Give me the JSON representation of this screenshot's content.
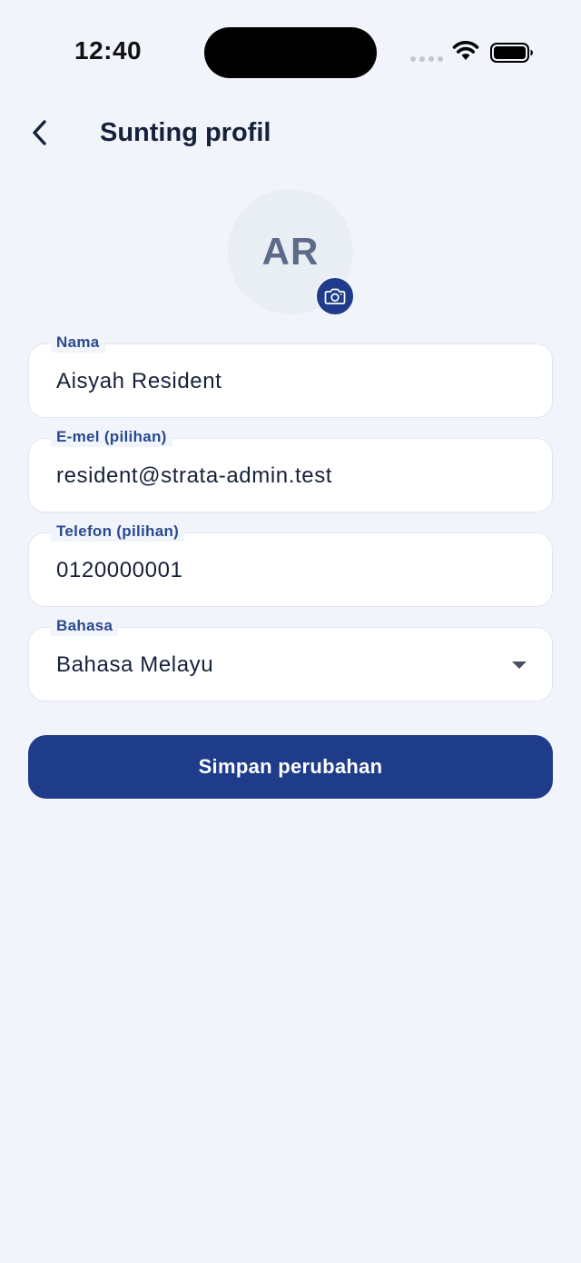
{
  "status_bar": {
    "time": "12:40"
  },
  "header": {
    "title": "Sunting profil",
    "back_icon": "chevron-left-icon"
  },
  "avatar": {
    "initials": "AR",
    "camera_icon": "camera-icon"
  },
  "form": {
    "fields": [
      {
        "label": "Nama",
        "value": "Aisyah Resident"
      },
      {
        "label": "E-mel (pilihan)",
        "value": "resident@strata-admin.test"
      },
      {
        "label": "Telefon (pilihan)",
        "value": "0120000001"
      }
    ],
    "language": {
      "label": "Bahasa",
      "selected": "Bahasa Melayu"
    },
    "save_label": "Simpan perubahan"
  },
  "colors": {
    "background": "#f2f4fc",
    "primary": "#1f3c8a",
    "label": "#2a4a8e"
  }
}
